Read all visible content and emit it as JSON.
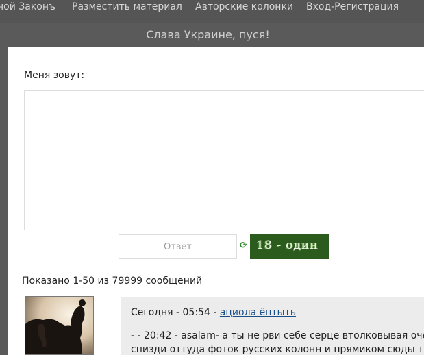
{
  "nav": {
    "items": [
      {
        "label": "ной Законъ"
      },
      {
        "label": "Разместить материал"
      },
      {
        "label": "Авторские колонки"
      },
      {
        "label": "Вход-Регистрация"
      }
    ]
  },
  "greeting": "Слава Украине, пуся!",
  "form": {
    "name_label": "Меня зовут:",
    "name_value": "",
    "message_value": "",
    "answer_placeholder": "Ответ",
    "captcha_text": "18 - один",
    "refresh_icon": "refresh-icon"
  },
  "messages": {
    "shown_text": "Показано 1-50 из 79999 сообщений",
    "items": [
      {
        "time": "Сегодня - 05:54 -",
        "author": "ациола ёптыть",
        "line1": "- - 20:42 - asalam- а ты не рви себе серце втолковывая очевид",
        "line2": "спизди оттуда фоток русских колонн и прямиком сюды тисни."
      }
    ]
  },
  "colors": {
    "captcha_bg": "#2b5b1d",
    "link": "#1a4f8a",
    "nav_bg": "#555555"
  }
}
